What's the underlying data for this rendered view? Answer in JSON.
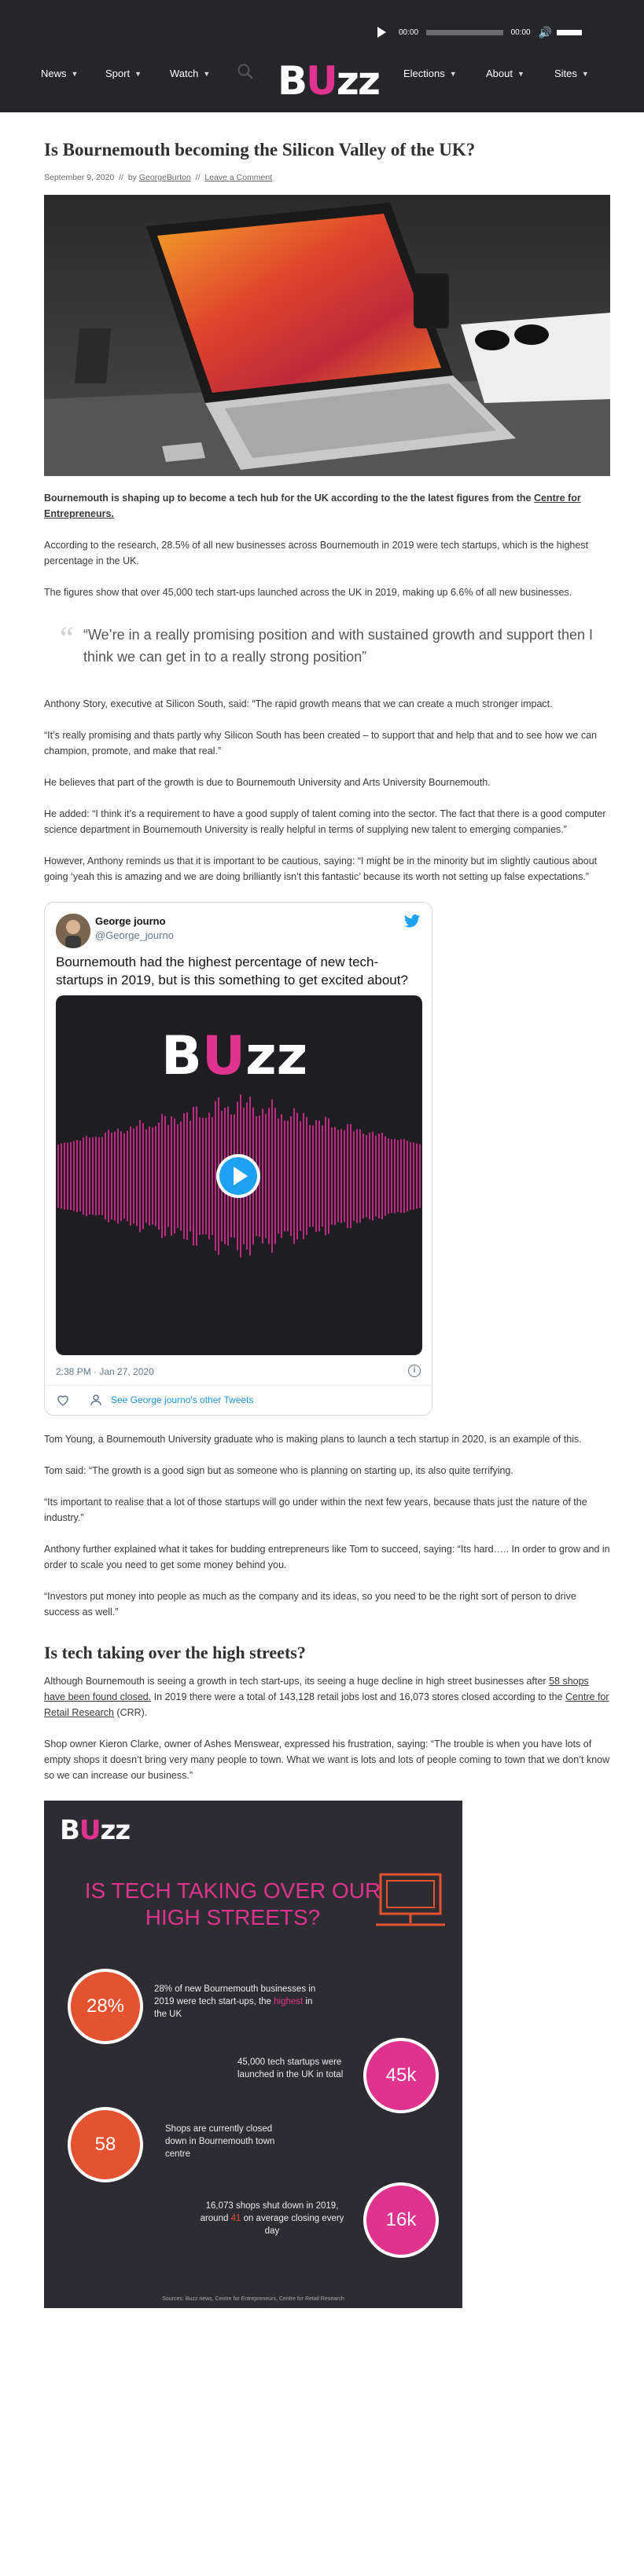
{
  "audio": {
    "time_start": "00:00",
    "time_end": "00:00"
  },
  "nav": {
    "left": [
      "News",
      "Sport",
      "Watch"
    ],
    "right": [
      "Elections",
      "About",
      "Sites"
    ],
    "logo_b": "B",
    "logo_u": "U",
    "logo_rest": "zz"
  },
  "article": {
    "title": "Is Bournemouth becoming the Silicon Valley of the UK?",
    "date": "September 9, 2020",
    "by": "by",
    "author": "GeorgeBurton",
    "comment_link": "Leave a Comment",
    "sep": "//",
    "lead_text": "Bournemouth is shaping up to become a tech hub for the UK according to the the latest figures from the ",
    "lead_link": "Centre for Entrepreneurs.",
    "p1": "According to the research, 28.5% of all new businesses across Bournemouth in 2019 were tech startups, which is the highest percentage in the UK.",
    "p2": "The figures show that over 45,000 tech start-ups launched across the UK in 2019, making up 6.6% of all new businesses.",
    "quote": "“We’re in a really promising position and with sustained growth and support then I think we can get in to a really strong position”",
    "p3": "Anthony Story, executive at Silicon South, said: “The rapid growth means that we can create a much stronger impact.",
    "p4": "“It’s really promising and thats partly why Silicon South has been created – to support that and help that and to see how we can champion, promote, and make that real.”",
    "p5": "He believes that part of the growth is due to Bournemouth University and Arts University Bournemouth.",
    "p6": "He added: “I think it’s a requirement to have a good supply of talent coming into the sector. The fact that there is a good computer science department in Bournemouth University is really helpful in terms of supplying new talent to emerging companies.”",
    "p7": "However, Anthony reminds us that it is important to be cautious, saying: “I might be in the minority but im slightly cautious about going ‘yeah this is amazing and we are doing brilliantly isn’t this fantastic’ because its worth not setting up false expectations.”",
    "p8": "Tom Young, a Bournemouth University graduate who is making plans to launch a tech startup in 2020, is an example of this.",
    "p9": "Tom said: “The growth is a good sign but as someone who is planning on starting up,  its also quite terrifying.",
    "p10": "“Its important to realise that a lot of those startups will go under within the next few years, because thats just the nature of the industry.”",
    "p11": "Anthony further explained what it takes for budding entrepreneurs like Tom to succeed, saying: “Its hard….. In order to grow and in order to scale you need to get some money behind you.",
    "p12": "“Investors put money into people as much as the company and its ideas, so you need to be the right sort of person to drive success as well.”",
    "h2": "Is tech taking over the high streets?",
    "p13_a": "Although Bournemouth is seeing a growth in tech start-ups, its seeing a huge decline in high street businesses after ",
    "p13_link": "58 shops have been found closed.",
    "p13_b": " In 2019 there were a total of 143,128 retail jobs lost and 16,073 stores closed according to the ",
    "p13_link2": "Centre for Retail Research",
    "p13_c": " (CRR).",
    "p14": "Shop owner Kieron Clarke,  owner of Ashes Menswear, expressed his frustration, saying: “The trouble is when you have lots of empty shops it doesn’t bring very many people to town. What we want is lots and lots of people coming to town that we don’t know so we can increase our business.”"
  },
  "tweet": {
    "name": "George journo",
    "handle": "@George_journo",
    "text": "Bournemouth had the highest percentage of new tech-startups in 2019, but is this something to get excited about?",
    "timestamp": "2:38 PM · Jan 27, 2020",
    "other_tweets": "See George journo's other Tweets",
    "info_glyph": "i"
  },
  "infographic": {
    "title": "IS TECH TAKING OVER OUR HIGH STREETS?",
    "stat1_value": "28%",
    "stat1_a": "28% of new Bournemouth businesses in 2019 were tech start-ups, the ",
    "stat1_hl": "highest",
    "stat1_b": " in the UK",
    "stat2_value": "45k",
    "stat2": "45,000 tech startups were launched in the UK in total",
    "stat3_value": "58",
    "stat3": "Shops are currently closed down in Bournemouth town centre",
    "stat4_value": "16k",
    "stat4_a": "16,073 shops shut down in 2019, around ",
    "stat4_hl": "41",
    "stat4_b": " on average closing every day",
    "source": "Sources: Buzz news, Centre for Entrepreneurs, Centre for Retail Research"
  },
  "colors": {
    "header_bg": "#25252a",
    "brand_pink": "#e0338f",
    "accent_orange": "#e55230",
    "tweet_blue": "#1da1f2"
  },
  "icons": [
    "play-icon",
    "volume-icon",
    "search-icon",
    "chevron-down-icon",
    "twitter-bird-icon",
    "info-icon",
    "heart-icon",
    "person-icon",
    "video-play-icon",
    "monitor-icon"
  ]
}
